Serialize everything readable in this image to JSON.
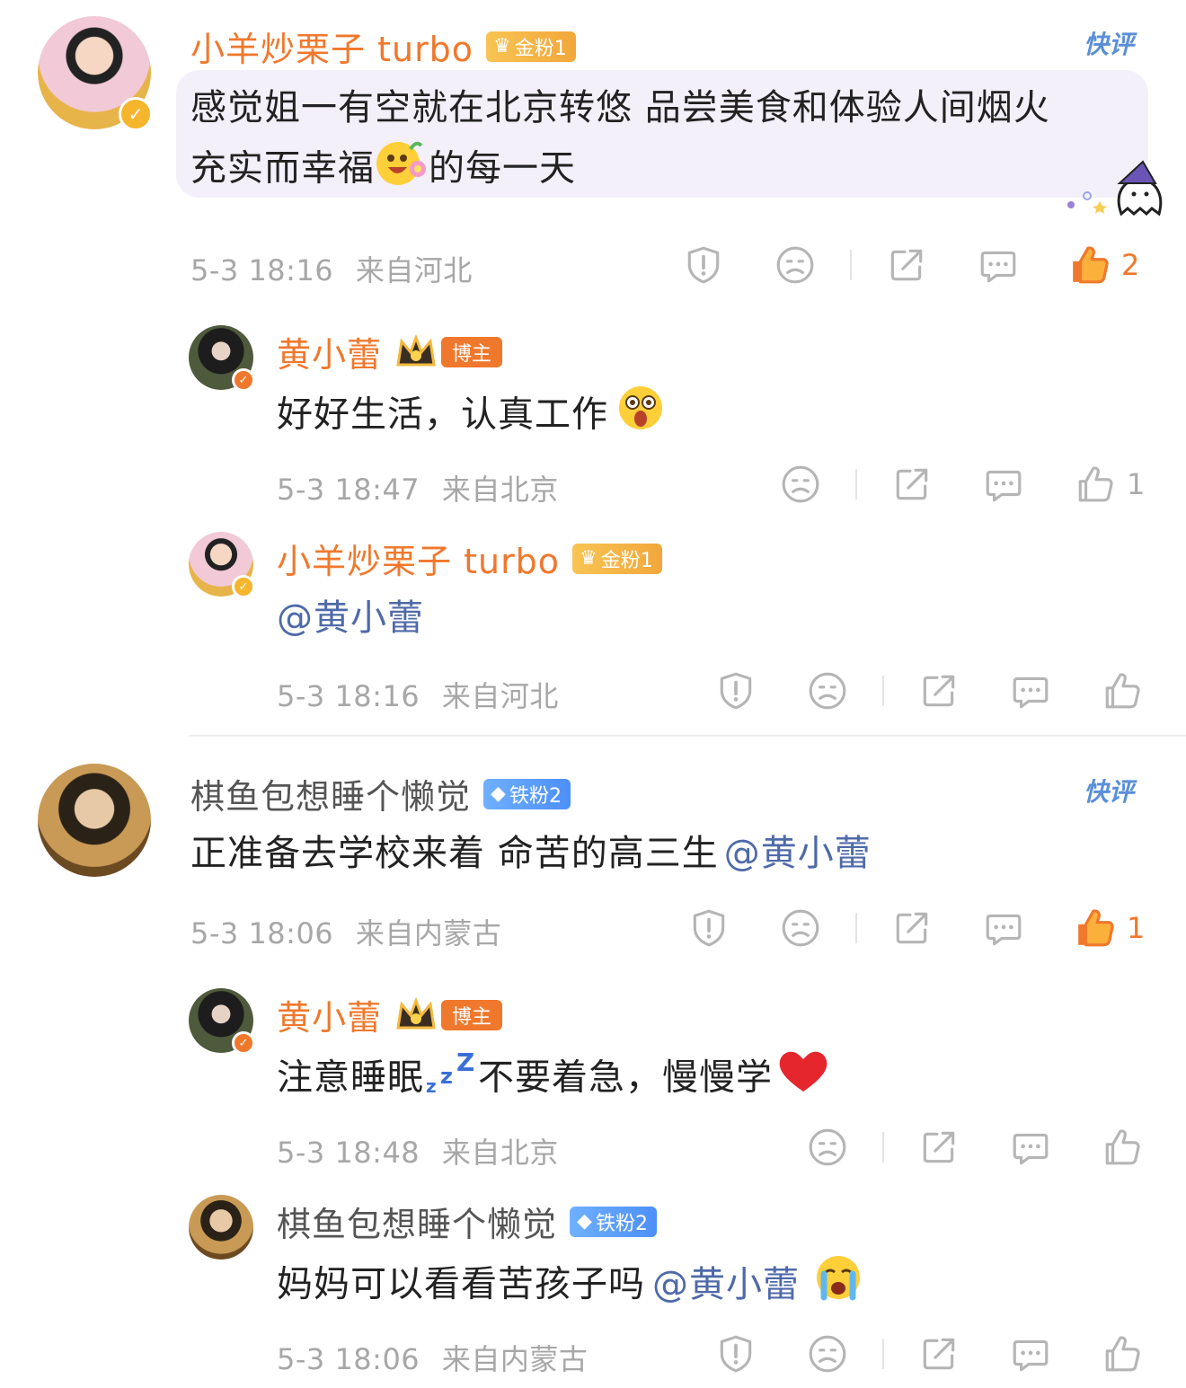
{
  "comments": [
    {
      "user": "小羊炒栗子 turbo",
      "badge": "金粉1",
      "quick": "快评",
      "line1": "感觉姐一有空就在北京转悠 品尝美食和体验人间烟火",
      "line2a": "充实而幸福",
      "line2b": "的每一天",
      "time": "5-3 18:16",
      "location": "来自河北",
      "likes": "2"
    },
    {
      "user": "黄小蕾",
      "badge": "博主",
      "text": "好好生活，认真工作",
      "time": "5-3 18:47",
      "location": "来自北京",
      "likes": "1"
    },
    {
      "user": "小羊炒栗子 turbo",
      "badge": "金粉1",
      "mention": "@黄小蕾",
      "time": "5-3 18:16",
      "location": "来自河北"
    },
    {
      "user": "棋鱼包想睡个懒觉",
      "badge": "铁粉2",
      "quick": "快评",
      "text": "正准备去学校来着 命苦的高三生",
      "mention": "@黄小蕾",
      "time": "5-3 18:06",
      "location": "来自内蒙古",
      "likes": "1"
    },
    {
      "user": "黄小蕾",
      "badge": "博主",
      "text_a": "注意睡眠",
      "text_b": "不要着急，慢慢学",
      "time": "5-3 18:48",
      "location": "来自北京"
    },
    {
      "user": "棋鱼包想睡个懒觉",
      "badge": "铁粉2",
      "text": "妈妈可以看看苦孩子吗",
      "mention": "@黄小蕾",
      "time": "5-3 18:06",
      "location": "来自内蒙古"
    }
  ],
  "colors": {
    "orange": "#f0782c",
    "gold_badge": "#f2a73b",
    "blue_badge": "#4d8ff7",
    "mention": "#4f6aa8",
    "meta_gray": "#a7a7a7",
    "bubble": "#f3f0fa"
  },
  "icons": [
    "report-icon",
    "dislike-icon",
    "share-icon",
    "reply-icon",
    "like-icon",
    "liked-icon"
  ]
}
